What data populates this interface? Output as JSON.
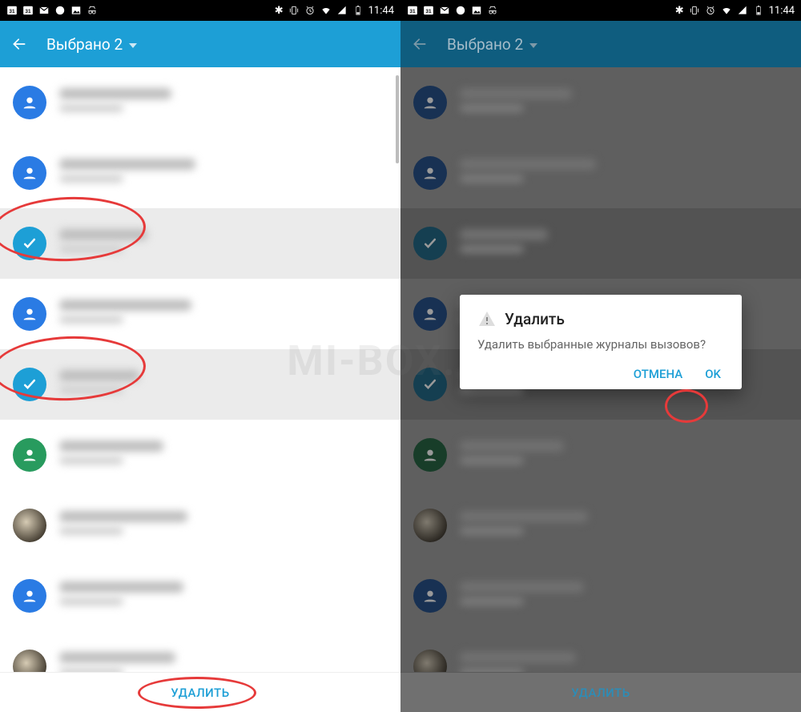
{
  "statusbar": {
    "time": "11:44",
    "icons_left": [
      "calendar-31-icon",
      "calendar-31-icon",
      "gmail-icon",
      "smiley-icon",
      "picture-icon",
      "incognito-icon"
    ],
    "icons_right": [
      "bluetooth-icon",
      "vibrate-icon",
      "alarm-icon",
      "wifi-icon",
      "cell-icon",
      "battery-icon"
    ]
  },
  "appbar": {
    "title": "Выбрано 2"
  },
  "list": {
    "rows": [
      {
        "type": "contact",
        "avatar": "blue",
        "selected": false
      },
      {
        "type": "contact",
        "avatar": "blue",
        "selected": false
      },
      {
        "type": "selected",
        "avatar": "check",
        "selected": true
      },
      {
        "type": "contact",
        "avatar": "blue",
        "selected": false
      },
      {
        "type": "selected",
        "avatar": "check",
        "selected": true
      },
      {
        "type": "contact",
        "avatar": "green",
        "selected": false
      },
      {
        "type": "photo",
        "avatar": "photo",
        "selected": false
      },
      {
        "type": "contact",
        "avatar": "blue",
        "selected": false
      },
      {
        "type": "photo",
        "avatar": "photo",
        "selected": false
      }
    ]
  },
  "actionbar": {
    "delete_label": "УДАЛИТЬ"
  },
  "dialog": {
    "title": "Удалить",
    "message": "Удалить выбранные журналы вызовов?",
    "cancel": "ОТМЕНА",
    "ok": "OK"
  },
  "watermark": "MI-BOX.RU"
}
